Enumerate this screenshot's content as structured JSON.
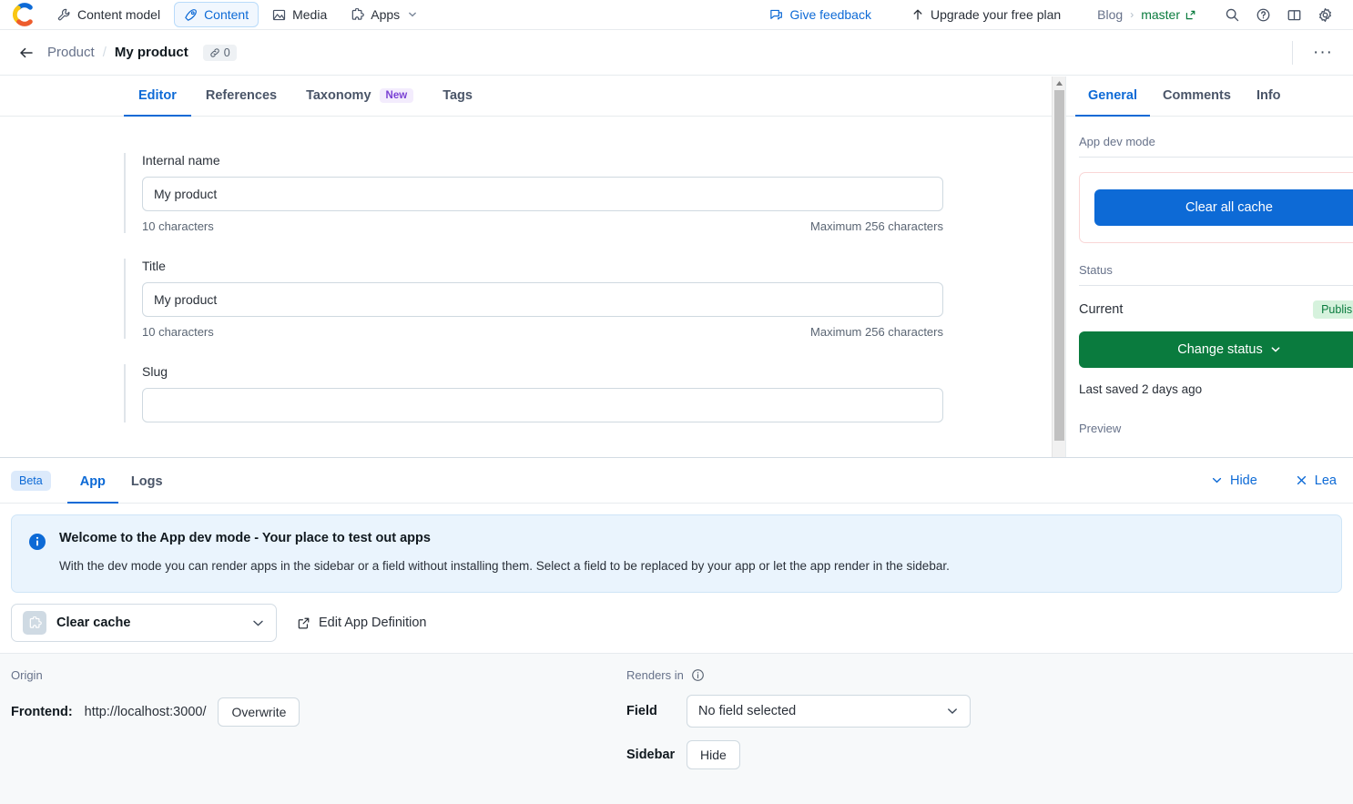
{
  "topnav": {
    "logo_name": "contentful-logo",
    "items": [
      {
        "label": "Content model",
        "icon": "wrench-icon",
        "active": false
      },
      {
        "label": "Content",
        "icon": "pen-icon",
        "active": true
      },
      {
        "label": "Media",
        "icon": "image-icon",
        "active": false
      },
      {
        "label": "Apps",
        "icon": "puzzle-icon",
        "active": false,
        "caret": true
      }
    ],
    "feedback_label": "Give feedback",
    "upgrade_label": "Upgrade your free plan",
    "space_name": "Blog",
    "environment_name": "master",
    "icons": [
      "search-icon",
      "help-icon",
      "docs-icon",
      "settings-icon"
    ]
  },
  "entry_header": {
    "content_type": "Product",
    "entry_title": "My product",
    "links_count": "0",
    "more_label": "···"
  },
  "editor": {
    "tabs": [
      {
        "label": "Editor",
        "active": true,
        "badge": null
      },
      {
        "label": "References",
        "active": false,
        "badge": null
      },
      {
        "label": "Taxonomy",
        "active": false,
        "badge": "New"
      },
      {
        "label": "Tags",
        "active": false,
        "badge": null
      }
    ],
    "fields": [
      {
        "label": "Internal name",
        "value": "My product",
        "char_count": "10 characters",
        "max_chars": "Maximum 256 characters"
      },
      {
        "label": "Title",
        "value": "My product",
        "char_count": "10 characters",
        "max_chars": "Maximum 256 characters"
      },
      {
        "label": "Slug",
        "value": "",
        "char_count": "",
        "max_chars": ""
      }
    ]
  },
  "sidebar": {
    "tabs": [
      {
        "label": "General",
        "active": true
      },
      {
        "label": "Comments",
        "active": false
      },
      {
        "label": "Info",
        "active": false
      }
    ],
    "dev_section_title": "App dev mode",
    "clear_all_cache_label": "Clear all cache",
    "status_section_title": "Status",
    "current_label": "Current",
    "status_badge": "Published",
    "change_status_label": "Change status",
    "last_saved": "Last saved 2 days ago",
    "preview_title": "Preview"
  },
  "devpanel": {
    "beta_label": "Beta",
    "tabs": [
      {
        "label": "App",
        "active": true
      },
      {
        "label": "Logs",
        "active": false
      }
    ],
    "hide_label": "Hide",
    "leave_label": "Lea",
    "notice": {
      "title": "Welcome to the App dev mode - Your place to test out apps",
      "body": "With the dev mode you can render apps in the sidebar or a field without installing them. Select a field to be replaced by your app or let the app render in the sidebar."
    },
    "app_select_label": "Clear cache",
    "edit_app_definition_label": "Edit App Definition",
    "origin": {
      "section_label": "Origin",
      "frontend_key": "Frontend:",
      "frontend_url": "http://localhost:3000/",
      "overwrite_label": "Overwrite"
    },
    "renders": {
      "section_label": "Renders in",
      "field_label": "Field",
      "field_value": "No field selected",
      "sidebar_label": "Sidebar",
      "sidebar_button": "Hide"
    }
  },
  "colors": {
    "accent_blue": "#0d6ad6",
    "green": "#0a7b3e",
    "badge_green_bg": "#d6f2dd",
    "purple": "#7a41d4",
    "notice_bg": "#eaf4fd"
  }
}
